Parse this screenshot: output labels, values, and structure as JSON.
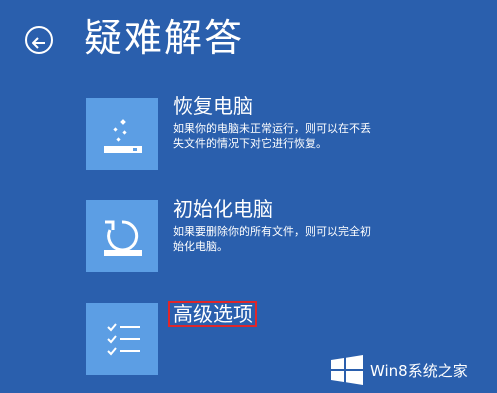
{
  "header": {
    "title": "疑难解答",
    "back_icon": "back-arrow-icon"
  },
  "options": [
    {
      "title": "恢复电脑",
      "description": "如果你的电脑未正常运行，则可以在不丢失文件的情况下对它进行恢复。",
      "icon": "refresh-pc-icon"
    },
    {
      "title": "初始化电脑",
      "description": "如果要删除你的所有文件，则可以完全初始化电脑。",
      "icon": "reset-pc-icon"
    },
    {
      "title": "高级选项",
      "icon": "advanced-options-icon",
      "highlighted": true
    }
  ],
  "watermark": {
    "text": "Win8系统之家",
    "icon": "windows-logo-icon"
  },
  "colors": {
    "background": "#2a5fad",
    "tile": "#5c9ee4",
    "highlight_border": "#e0262a"
  }
}
